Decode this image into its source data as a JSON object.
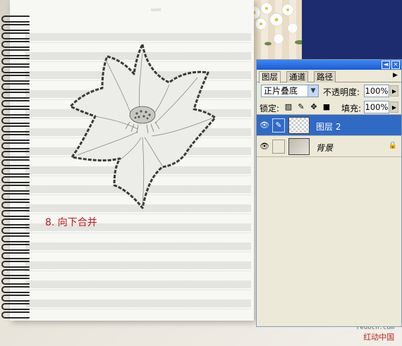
{
  "canvas": {
    "notebook_header": "NAME",
    "step_caption": "8. 向下合并",
    "watermark_site": "redocn.com",
    "watermark_name": "红动中国"
  },
  "layers_panel": {
    "title_buttons": [
      "◄",
      "×"
    ],
    "tabs": [
      {
        "label": "图层",
        "active": true
      },
      {
        "label": "通道",
        "active": false
      },
      {
        "label": "路径",
        "active": false
      }
    ],
    "menu_icon": "panel-menu-arrow",
    "blend_mode": "正片叠底",
    "opacity_label": "不透明度:",
    "opacity_value": "100%",
    "lock_label": "锁定:",
    "fill_label": "填充:",
    "fill_value": "100%",
    "layers": [
      {
        "name": "图层 2",
        "selected": true,
        "visible": true,
        "thumbnail": "transparent-checker",
        "italic": false
      },
      {
        "name": "背景",
        "selected": false,
        "visible": true,
        "thumbnail": "photo",
        "italic": true,
        "locked": true
      }
    ]
  },
  "colors": {
    "selection_blue": "#316ac5",
    "caption_red": "#c01818",
    "panel_bg": "#ece9d8",
    "title_bar_blue": "#1f5bd1"
  }
}
